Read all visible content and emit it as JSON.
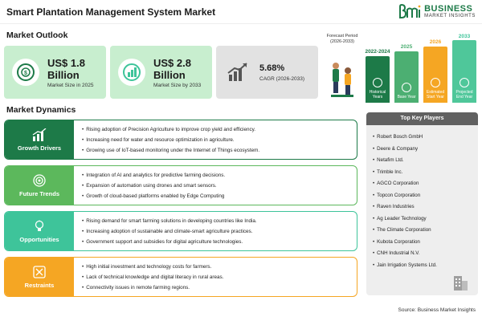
{
  "header": {
    "title": "Smart Plantation Management System Market",
    "logo_line1": "BUSINESS",
    "logo_line2": "MARKET INSIGHTS"
  },
  "outlook": {
    "heading": "Market Outlook",
    "cards": [
      {
        "value": "US$ 1.8",
        "value2": "Billion",
        "label": "Market Size in 2025",
        "icon": "dollar-target-icon"
      },
      {
        "value": "US$ 2.8",
        "value2": "Billion",
        "label": "Market Size by 2033",
        "icon": "dollar-chart-icon"
      },
      {
        "value": "5.68%",
        "value2": "",
        "label": "CAGR (2026-2033)",
        "icon": "growth-chart-icon"
      }
    ]
  },
  "timeline": {
    "forecast_label": "Forecast Period",
    "forecast_range": "(2026-2033)",
    "items": [
      {
        "year": "2022-2024",
        "label": "Historical Years",
        "color": "#1d7a48"
      },
      {
        "year": "2025",
        "label": "Base Year",
        "color": "#4caf72"
      },
      {
        "year": "2026",
        "label": "Estimated Start Year",
        "color": "#f5a623"
      },
      {
        "year": "2033",
        "label": "Projected End Year",
        "color": "#4fc79a"
      }
    ]
  },
  "dynamics": {
    "heading": "Market Dynamics",
    "blocks": [
      {
        "title": "Growth Drivers",
        "color": "#1d7a48",
        "border": "#1d7a48",
        "icon": "bar-growth-icon",
        "points": [
          "Rising adoption of Precision Agriculture to improve crop yield and efficiency.",
          "Increasing need for water and resource optimization in agriculture.",
          "Growing use of IoT-based monitoring under the Internet of Things ecosystem."
        ]
      },
      {
        "title": "Future Trends",
        "color": "#5cb85c",
        "border": "#5cb85c",
        "icon": "target-icon",
        "points": [
          "Integration of AI and analytics for predictive farming decisions.",
          "Expansion of automation using drones and smart sensors.",
          "Growth of cloud-based platforms enabled by Edge Computing"
        ]
      },
      {
        "title": "Opportunities",
        "color": "#3ec49a",
        "border": "#3ec49a",
        "icon": "lightbulb-icon",
        "points": [
          "Rising demand for smart farming solutions in developing countries like India.",
          "Increasing adoption of sustainable and climate-smart agriculture practices.",
          "Government support and subsidies for digital agriculture technologies."
        ]
      },
      {
        "title": "Restraints",
        "color": "#f5a623",
        "border": "#f5a623",
        "icon": "restraint-icon",
        "points": [
          "High initial investment and technology costs for farmers.",
          "Lack of technical knowledge and digital literacy in rural areas.",
          "Connectivity issues in remote farming regions."
        ]
      }
    ]
  },
  "players": {
    "heading": "Top Key Players",
    "items": [
      "Robert Bosch GmbH",
      "Deere & Company",
      "Netafim Ltd.",
      "Trimble Inc.",
      "AGCO Corporation",
      "Topcon Corporation",
      "Raven Industries",
      "Ag Leader Technology",
      "The Climate Corporation",
      "Kubota Corporation",
      "CNH Industrial N.V.",
      "Jain Irrigation Systems Ltd."
    ]
  },
  "source": "Source: Business Market Insights"
}
